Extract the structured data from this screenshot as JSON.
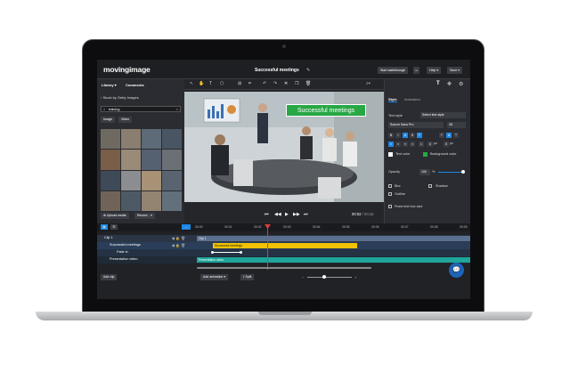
{
  "app": {
    "logo": "movingimage",
    "project_title": "Successful meetings",
    "start_walkthrough": "Start walkthrough",
    "help": "Help ▾",
    "save": "Save ▾"
  },
  "left": {
    "tabs": [
      "Library ▾",
      "Comments"
    ],
    "breadcrumb": "Stock by Getty Images",
    "search_value": "training",
    "filters": [
      "Image",
      "Video"
    ],
    "upload": "Upload media",
    "record": "Record... ▾"
  },
  "player": {
    "overlay_title": "Successful meetings",
    "time_current": "00:02",
    "time_total": "00:18",
    "time_sep": " / "
  },
  "right": {
    "tabs": [
      "Style",
      "Animation"
    ],
    "text_style_label": "Text style",
    "text_style_value": "Select text style",
    "font_value": "Source Sans Pro",
    "font_size": "28",
    "format_buttons": [
      "B",
      "I",
      "U",
      "S",
      "T",
      "T",
      "A",
      "⊤"
    ],
    "spacing_values": [
      "1",
      "0",
      "px",
      "0",
      "px"
    ],
    "text_color": "Text color",
    "background_color": "Background color",
    "opacity_label": "Opacity",
    "opacity_value": "100",
    "opacity_unit": "%",
    "blur": "Blur",
    "shadow": "Shadow",
    "outline": "Outline",
    "fixed_text_box": "Fixed text box size"
  },
  "timeline": {
    "ticks": [
      "00:00",
      "00:01",
      "00:02",
      "00:03",
      "00:04",
      "00:05",
      "00:06",
      "00:07",
      "00:08",
      "00:09"
    ],
    "rows": [
      {
        "label": "Clip 1",
        "bar": "Clip 1"
      },
      {
        "label": "Successful meetings",
        "bar": "Successful meetings"
      },
      {
        "label": "Fade in",
        "bar": ""
      },
      {
        "label": "Presentation video",
        "bar": "Presentation video"
      }
    ],
    "add_clip": "Add clip",
    "add_animation": "Add animation ▾",
    "split": "Split"
  },
  "colors": {
    "accent": "#1e88e5",
    "title_bar": "#f2c200",
    "video_bar": "#1fa59a",
    "clip_bar": "#5b6f8e",
    "overlay_green": "#28a745"
  }
}
